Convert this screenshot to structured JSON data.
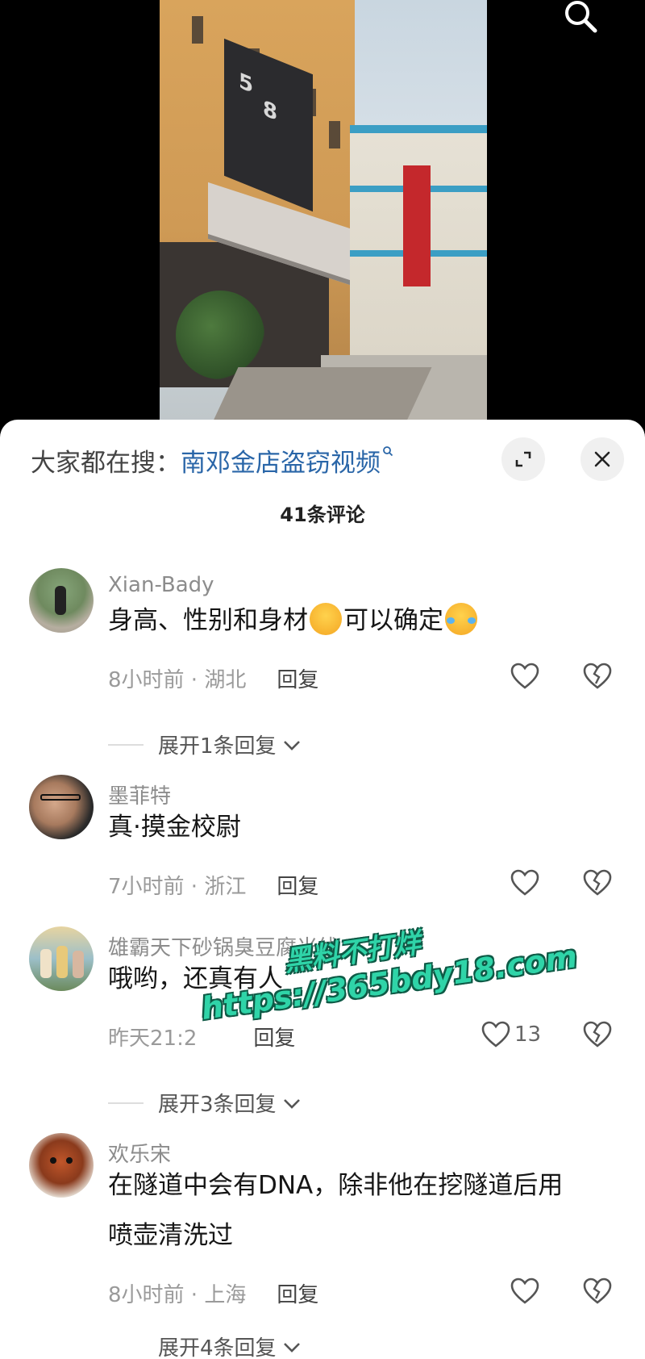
{
  "header": {
    "search_icon": "search-icon"
  },
  "sheet": {
    "hot_search_label": "大家都在搜：",
    "hot_search_query": "南邓金店盗窃视频",
    "comment_count": "41条评论",
    "expand_icon": "expand-icon",
    "close_icon": "close-icon"
  },
  "comments": [
    {
      "user": "Xian-Bady",
      "text_a": "身高、性别和身材",
      "text_b": "可以确定",
      "time_loc": "8小时前 · 湖北",
      "reply": "回复",
      "expand": "展开1条回复"
    },
    {
      "user": "墨菲特",
      "text": "真·摸金校尉",
      "time_loc": "7小时前 · 浙江",
      "reply": "回复"
    },
    {
      "user": "雄霸天下砂锅臭豆腐米线",
      "text": "哦哟，还真有人",
      "time_loc": "昨天21:2",
      "reply": "回复",
      "likes": "13",
      "expand": "展开3条回复"
    },
    {
      "user": "欢乐宋",
      "text_line1": "在隧道中会有DNA，除非他在挖隧道后用",
      "text_line2": "喷壶清洗过",
      "time_loc": "8小时前 · 上海",
      "reply": "回复",
      "expand": "展开4条回复"
    }
  ],
  "watermark": {
    "line1": "黑料不打烊",
    "line2": "https://365bdy18.com"
  },
  "colors": {
    "link": "#2a66a8",
    "watermark": "#2fd4a8"
  }
}
